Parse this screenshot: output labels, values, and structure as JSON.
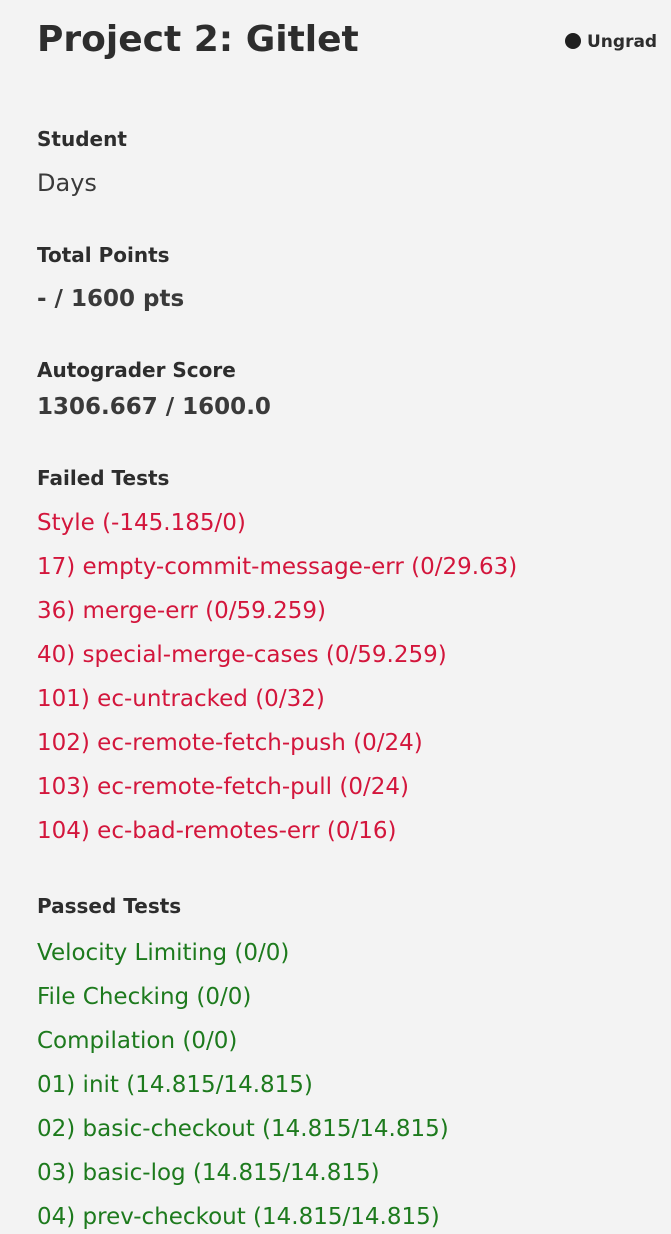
{
  "header": {
    "title": "Project 2: Gitlet",
    "status": "Ungrad"
  },
  "student": {
    "label": "Student",
    "value": "Days"
  },
  "total_points": {
    "label": "Total Points",
    "value": "- / 1600 pts"
  },
  "autograder": {
    "label": "Autograder Score",
    "value": "1306.667 / 1600.0"
  },
  "failed": {
    "label": "Failed Tests",
    "items": [
      "Style (-145.185/0)",
      "17) empty-commit-message-err (0/29.63)",
      "36) merge-err (0/59.259)",
      "40) special-merge-cases (0/59.259)",
      "101) ec-untracked (0/32)",
      "102) ec-remote-fetch-push (0/24)",
      "103) ec-remote-fetch-pull (0/24)",
      "104) ec-bad-remotes-err (0/16)"
    ]
  },
  "passed": {
    "label": "Passed Tests",
    "items": [
      "Velocity Limiting (0/0)",
      "File Checking (0/0)",
      "Compilation (0/0)",
      "01) init (14.815/14.815)",
      "02) basic-checkout (14.815/14.815)",
      "03) basic-log (14.815/14.815)",
      "04) prev-checkout (14.815/14.815)"
    ]
  },
  "colors": {
    "failed": "#d3163c",
    "passed": "#1d7a1d",
    "background": "#f3f3f3"
  }
}
